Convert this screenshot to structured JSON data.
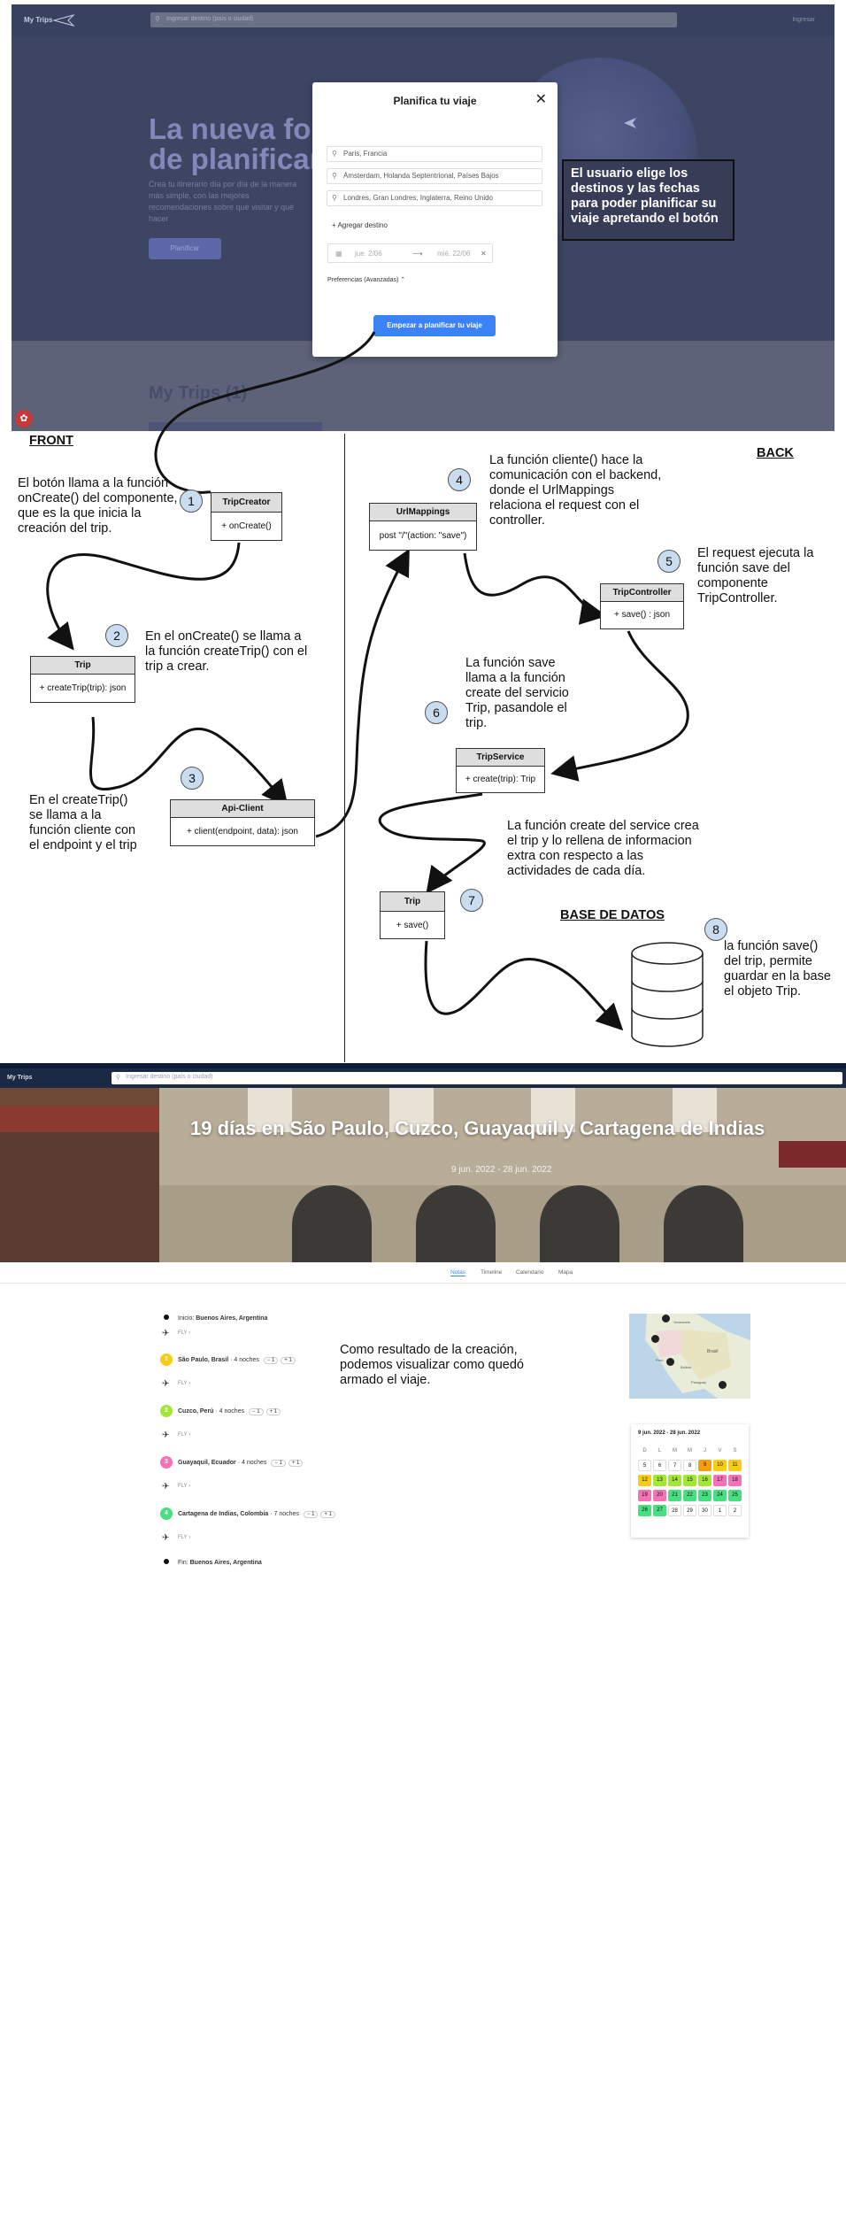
{
  "top_app": {
    "brand": "My Trips",
    "search_placeholder": "Ingresar destino (país o ciudad)",
    "login": "Ingresar",
    "hero_title_line1": "La nueva forma",
    "hero_title_line2": "de planificar",
    "hero_subtitle": "Crea tu itinerario día por día de la manera más simple, con las mejores recomendaciones sobre qué visitar y qué hacer",
    "hero_button": "Planificar",
    "my_trips_title": "My Trips (1)",
    "modal": {
      "title": "Planifica tu viaje",
      "destinations": [
        "Paris, Francia",
        "Ámsterdam, Holanda Septentrional, Países Bajos",
        "Londres, Gran Londres, Inglaterra, Reino Unido"
      ],
      "add_destination": "+ Agregar destino",
      "date_from": "jue. 2/06",
      "date_to": "mié. 22/06",
      "preferences": "Preferencias (Avanzadas) ⌃",
      "submit": "Empezar a planificar tu viaje"
    }
  },
  "callout": "El usuario elige los destinos y las fechas para poder planificar su viaje apretando el botón",
  "diagram": {
    "front_header": "FRONT",
    "back_header": "BACK",
    "db_header": "BASE DE DATOS",
    "notes": {
      "n1": "El botón llama a la función onCreate() del componente, que es la que inicia la creación del trip.",
      "n2": "En el onCreate() se llama a la función createTrip() con el trip a crear.",
      "n3": "En el createTrip() se llama a la función cliente con el endpoint y el trip",
      "n4": "La función cliente() hace la comunicación con el backend, donde el UrlMappings relaciona el request con el controller.",
      "n5": "El request ejecuta la función save del componente TripController.",
      "n6": "La función save llama a la función create del servicio Trip, pasandole el trip.",
      "n7": "La función create del service crea el trip y lo rellena de informacion extra con respecto a las actividades de cada día.",
      "n8": "la función save() del trip, permite guardar en la base el objeto Trip."
    },
    "steps": [
      "1",
      "2",
      "3",
      "4",
      "5",
      "6",
      "7",
      "8"
    ],
    "boxes": {
      "trip_creator": {
        "name": "TripCreator",
        "method": "+ onCreate()"
      },
      "trip_front": {
        "name": "Trip",
        "method": "+ createTrip(trip): json"
      },
      "api_client": {
        "name": "Api-Client",
        "method": "+ client(endpoint, data): json"
      },
      "url_mappings": {
        "name": "UrlMappings",
        "method": "post \"/\"(action: \"save\")"
      },
      "trip_controller": {
        "name": "TripController",
        "method": "+ save() : json"
      },
      "trip_service": {
        "name": "TripService",
        "method": "+ create(trip): Trip"
      },
      "trip_back": {
        "name": "Trip",
        "method": "+ save()"
      }
    }
  },
  "result_app": {
    "search_placeholder": "Ingresar destino (país o ciudad)",
    "trip_title": "19 días en São Paulo, Cuzco, Guayaquil y Cartagena de Indias",
    "trip_dates": "9 jun. 2022 - 28 jun. 2022",
    "tabs": [
      "Notas",
      "Timeline",
      "Calendario",
      "Mapa"
    ],
    "start": {
      "prefix": "Inicio: ",
      "city": "Buenos Aires, Argentina"
    },
    "end": {
      "prefix": "Fin: ",
      "city": "Buenos Aires, Argentina"
    },
    "fly": "FLY ›",
    "stops": [
      {
        "n": "1",
        "city": "São Paulo, Brasil",
        "nights": "· 4 noches",
        "color": "#facc15"
      },
      {
        "n": "2",
        "city": "Cuzco, Perú",
        "nights": "· 4 noches",
        "color": "#a3e635"
      },
      {
        "n": "3",
        "city": "Guayaquil, Ecuador",
        "nights": "· 4 noches",
        "color": "#f472b6"
      },
      {
        "n": "4",
        "city": "Cartagena de Indias, Colombia",
        "nights": "· 7 noches",
        "color": "#4ade80"
      }
    ],
    "pill_minus": "− 1",
    "pill_plus": "+ 1",
    "calendar_title": "9 jun. 2022 - 28 jun. 2022",
    "weekdays": [
      "D",
      "L",
      "M",
      "M",
      "J",
      "V",
      "S"
    ],
    "calendar_days": [
      "5",
      "6",
      "7",
      "8",
      "9",
      "10",
      "11",
      "12",
      "13",
      "14",
      "15",
      "16",
      "17",
      "18",
      "19",
      "20",
      "21",
      "22",
      "23",
      "24",
      "25",
      "26",
      "27",
      "28",
      "29",
      "30",
      "1",
      "2"
    ],
    "map_labels": [
      "Venezuela",
      "Brasil",
      "Bolivia",
      "Paraguay",
      "Perú"
    ]
  },
  "result_note": "Como resultado de la creación, podemos visualizar como quedó armado el viaje."
}
